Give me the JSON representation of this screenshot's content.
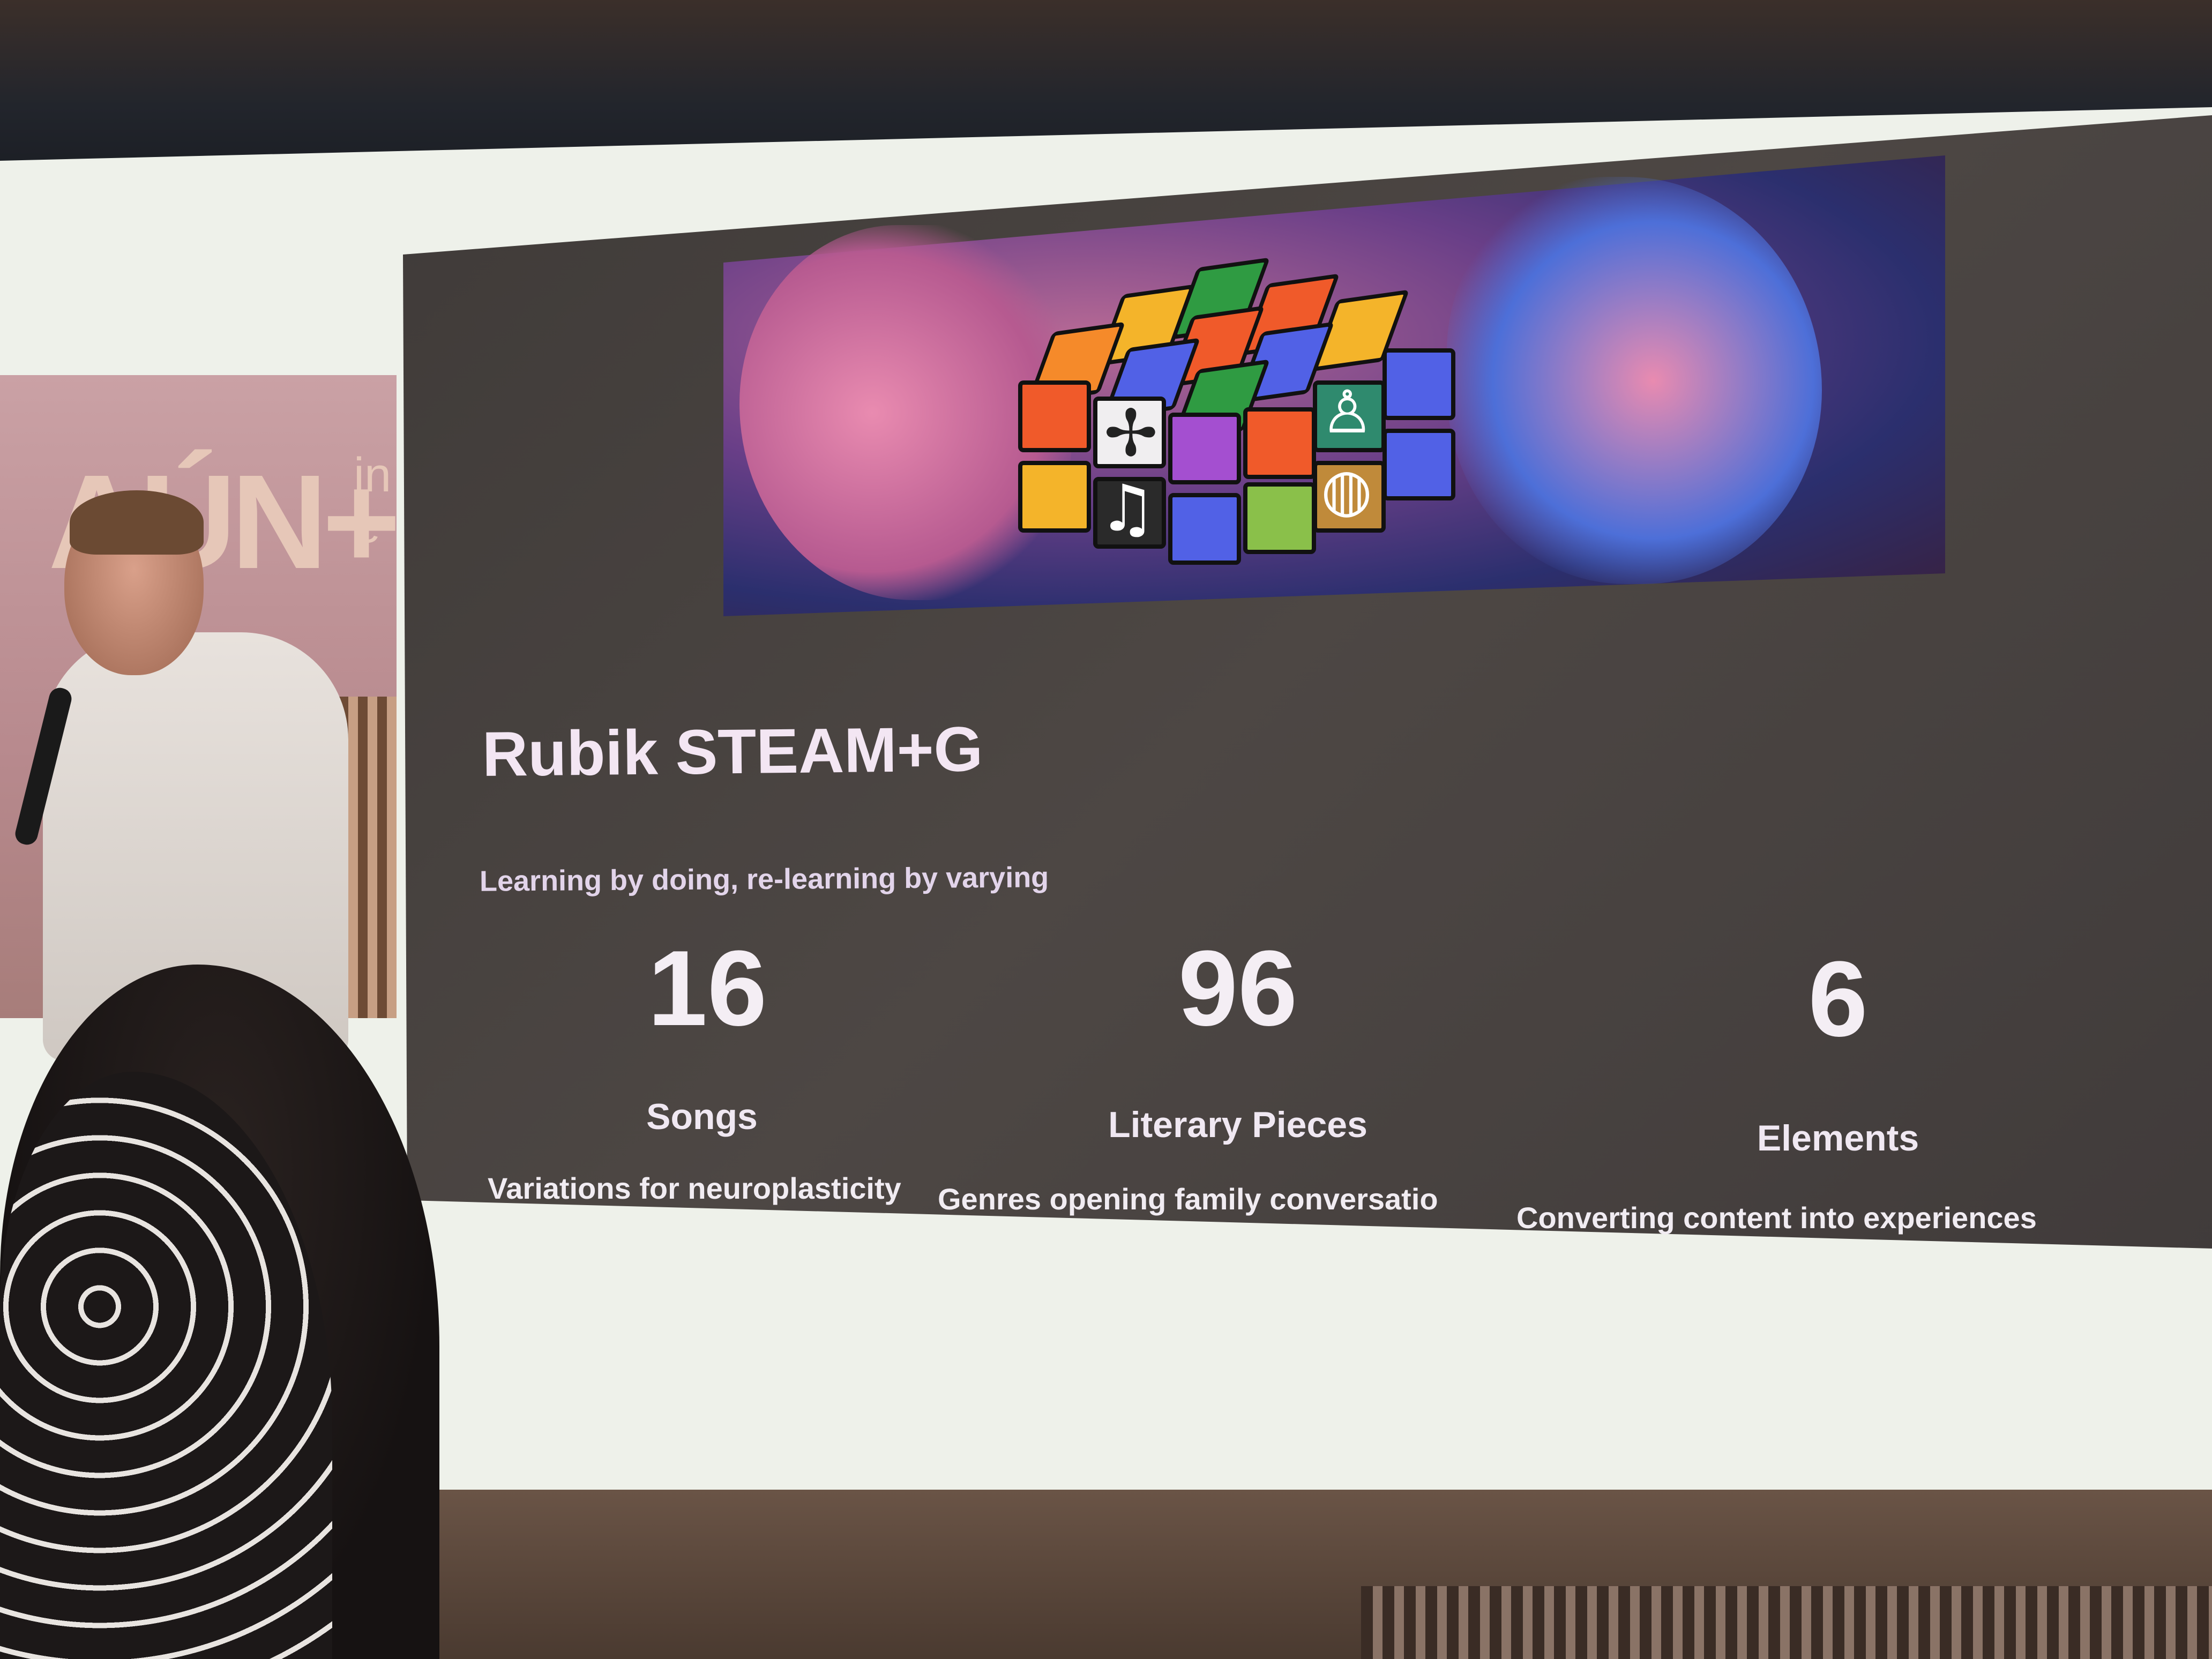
{
  "slide": {
    "title": "Rubik STEAM+G",
    "tagline": "Learning by doing, re-learning by varying",
    "stats": [
      {
        "number": "16",
        "label": "Songs",
        "description": "Variations for neuroplasticity"
      },
      {
        "number": "96",
        "label": "Literary Pieces",
        "description": "Genres opening family conversatio"
      },
      {
        "number": "6",
        "label": "Elements",
        "description": "Converting content into experiences"
      }
    ]
  },
  "banner": {
    "logo_text": "AÚN+",
    "sub_text": "in\ne"
  },
  "cube_icons": {
    "music": "♫",
    "compass": "✢",
    "globe": "◍",
    "person": "♙"
  }
}
